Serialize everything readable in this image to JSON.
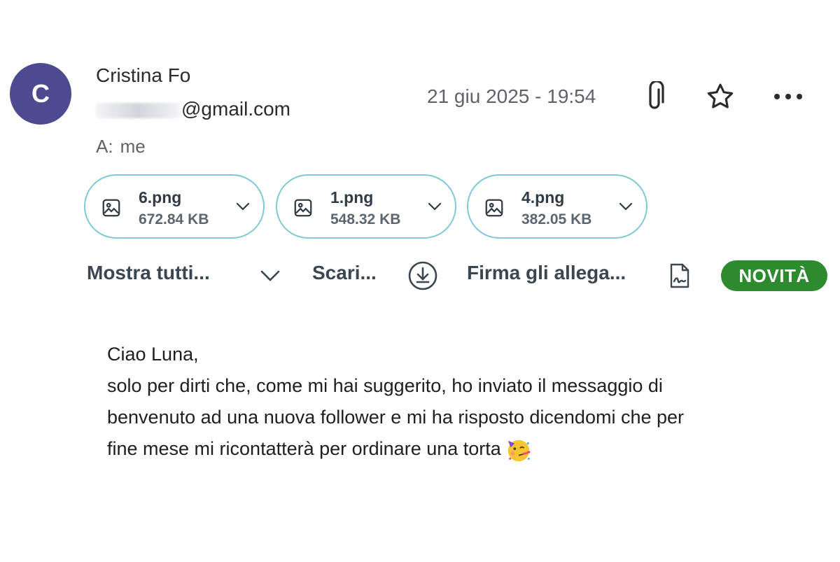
{
  "sender": {
    "avatar_letter": "C",
    "name": "Cristina Fo",
    "email_visible": "@gmail.com"
  },
  "date": "21 giu 2025 - 19:54",
  "header_icons": [
    "paperclip-icon",
    "star-icon",
    "more-icon"
  ],
  "recipient": {
    "label": "A:",
    "value": "me"
  },
  "attachments": [
    {
      "name": "6.png",
      "size": "672.84 KB"
    },
    {
      "name": "1.png",
      "size": "548.32 KB"
    },
    {
      "name": "4.png",
      "size": "382.05 KB"
    }
  ],
  "actions": {
    "show_all": "Mostra tutti...",
    "download": "Scari...",
    "sign": "Firma gli allega...",
    "badge": "NOVITÀ"
  },
  "colors": {
    "avatar": "#4d4a8f",
    "attachment_border": "#7fc8d8",
    "badge": "#2e8a2e"
  },
  "message": {
    "greeting": "Ciao Luna,",
    "lines": [
      "solo per dirti che, come mi hai suggerito, ho inviato il messaggio di",
      "benvenuto ad una nuova follower e mi ha risposto dicendomi che per",
      "fine mese mi ricontatterà per ordinare una torta"
    ],
    "emoji": "party-face-emoji"
  }
}
